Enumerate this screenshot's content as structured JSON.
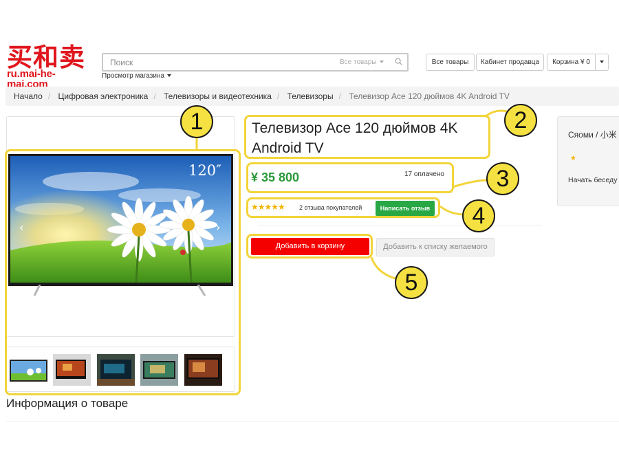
{
  "header": {
    "logo_cn": "买和卖",
    "logo_url": "ru.mai-he-mai.com",
    "search_placeholder": "Поиск",
    "search_scope": "Все товары",
    "store_view": "Просмотр магазина",
    "buttons": {
      "all_products": "Все товары",
      "seller_cabinet": "Кабинет продавца",
      "cart": "Корзина ¥ 0"
    }
  },
  "breadcrumb": [
    "Начало",
    "Цифровая электроника",
    "Телевизоры и видеотехника",
    "Телевизоры",
    "Телевизор Ace 120 дюймов 4K Android TV"
  ],
  "gallery": {
    "screen_label": "120″",
    "thumbnails": 5
  },
  "product": {
    "title": "Телевизор Ace 120 дюймов 4K Android TV",
    "price": "¥ 35 800",
    "paid_count": "17 оплачено",
    "stars": "★★★★★",
    "reviews": "2 отзыва покупателей",
    "write_review": "Написать отзыв",
    "add_to_cart": "Добавить в корзину",
    "add_to_wishlist": "Добавить к списку желаемого",
    "info_heading": "Информация о товаре"
  },
  "seller": {
    "name": "Сяоми / 小米",
    "star": "★",
    "chat": "Начать беседу"
  },
  "annotations": [
    "1",
    "2",
    "3",
    "4",
    "5"
  ],
  "colors": {
    "brand_red": "#e0161d",
    "cart_red": "#f50000",
    "price_green": "#2b9a3a",
    "review_green": "#28a745",
    "annotation_yellow": "#f2d43a"
  }
}
